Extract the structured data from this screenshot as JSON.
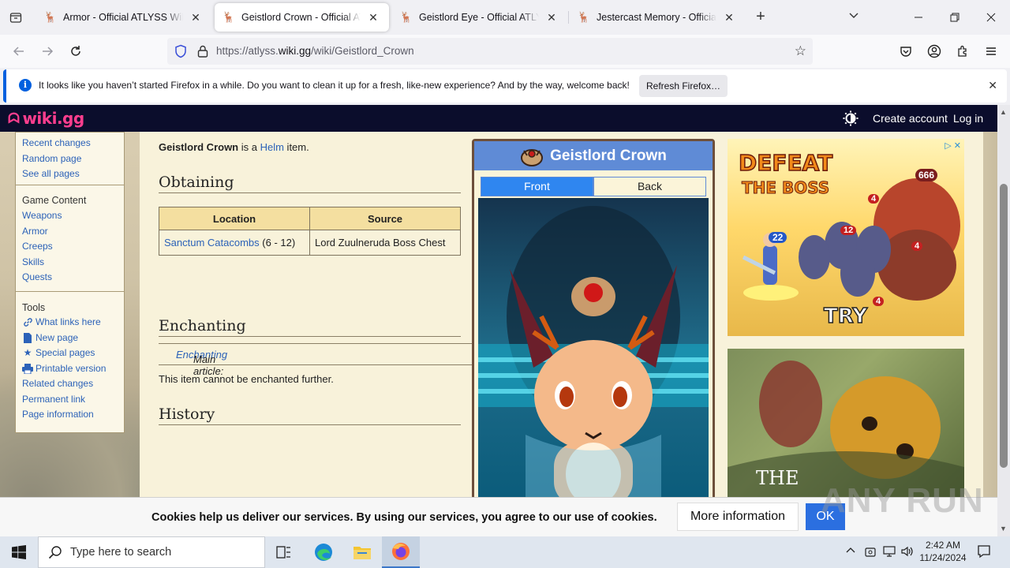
{
  "browser": {
    "tabs": [
      {
        "title": "Armor - Official ATLYSS Wiki",
        "active": false
      },
      {
        "title": "Geistlord Crown - Official ATLYSS Wiki",
        "active": true
      },
      {
        "title": "Geistlord Eye - Official ATLYSS Wiki",
        "active": false
      },
      {
        "title": "Jestercast Memory - Official ATLYSS Wiki",
        "active": false
      }
    ],
    "url_prefix": "https://atlyss.",
    "url_domain": "wiki.gg",
    "url_path": "/wiki/Geistlord_Crown",
    "notification": "It looks like you haven’t started Firefox in a while. Do you want to clean it up for a fresh, like-new experience? And by the way, welcome back!",
    "notification_button": "Refresh Firefox…"
  },
  "wiki": {
    "logo": "wiki.gg",
    "create_account": "Create account",
    "log_in": "Log in"
  },
  "sidebar": {
    "nav_links": [
      "Recent changes",
      "Random page",
      "See all pages"
    ],
    "game_content_heading": "Game Content",
    "game_content_links": [
      "Weapons",
      "Armor",
      "Creeps",
      "Skills",
      "Quests"
    ],
    "tools_heading": "Tools",
    "tools_links": [
      {
        "label": "What links here",
        "icon": "link-icon"
      },
      {
        "label": "New page",
        "icon": "page-icon"
      },
      {
        "label": "Special pages",
        "icon": "star-icon"
      },
      {
        "label": "Printable version",
        "icon": "printer-icon"
      },
      {
        "label": "Related changes",
        "icon": ""
      },
      {
        "label": "Permanent link",
        "icon": ""
      },
      {
        "label": "Page information",
        "icon": ""
      }
    ]
  },
  "article": {
    "intro_bold": "Geistlord Crown",
    "intro_mid": " is a ",
    "intro_link": "Helm",
    "intro_end": " item.",
    "h_obtaining": "Obtaining",
    "table": {
      "headers": [
        "Location",
        "Source"
      ],
      "rows": [
        {
          "location_link": "Sanctum Catacombs",
          "location_suffix": " (6 - 12)",
          "source": "Lord Zuulneruda Boss Chest"
        }
      ]
    },
    "h_enchanting": "Enchanting",
    "hatnote_prefix": "Main article: ",
    "hatnote_link": "Enchanting",
    "enchant_text": "This item cannot be enchanted further.",
    "h_history": "History"
  },
  "infobox": {
    "title": "Geistlord Crown",
    "tab_front": "Front",
    "tab_back": "Back"
  },
  "ads": {
    "ad1_headline_1": "DEFEAT",
    "ad1_headline_2": "THE BOSS",
    "ad1_cta": "TRY",
    "ad1_numbers": [
      "666",
      "4",
      "22",
      "12",
      "4",
      "4"
    ],
    "ad2_text": "THE"
  },
  "cookie": {
    "text": "Cookies help us deliver our services. By using our services, you agree to our use of cookies.",
    "more": "More information",
    "ok": "OK"
  },
  "watermark": "ANY RUN",
  "taskbar": {
    "search_placeholder": "Type here to search",
    "time": "2:42 AM",
    "date": "11/24/2024"
  }
}
